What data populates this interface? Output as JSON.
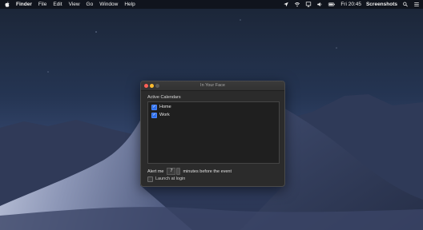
{
  "menubar": {
    "app_name": "Finder",
    "items": [
      "File",
      "Edit",
      "View",
      "Go",
      "Window",
      "Help"
    ],
    "status": {
      "clock": "Fri 20:45",
      "right_label": "Screenshots",
      "icons": [
        "location-icon",
        "wifi-icon",
        "airplay-icon",
        "volume-icon",
        "battery-icon"
      ]
    }
  },
  "window": {
    "title": "In Your Face",
    "traffic_colors": {
      "close": "#ff5f57",
      "minimize": "#febc2e",
      "zoom": "#5a5a5a"
    },
    "section_label": "Active Calendars",
    "calendars": [
      {
        "label": "Home",
        "checked": true
      },
      {
        "label": "Work",
        "checked": true
      }
    ],
    "alert": {
      "prefix": "Alert me",
      "value": "7",
      "suffix": "minutes before the event"
    },
    "launch_at_login": {
      "label": "Launch at login",
      "checked": false
    },
    "accent_color": "#2e6ee8"
  }
}
